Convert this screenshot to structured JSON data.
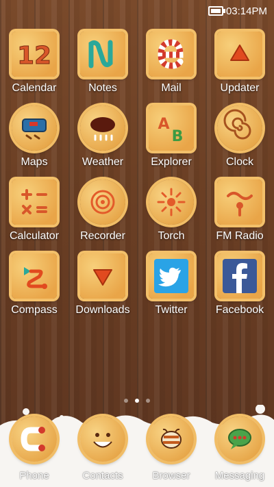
{
  "status_bar": {
    "time": "03:14PM"
  },
  "apps": [
    {
      "label": "Calendar",
      "icon": "calendar-icon"
    },
    {
      "label": "Notes",
      "icon": "notes-icon"
    },
    {
      "label": "Mail",
      "icon": "mail-icon"
    },
    {
      "label": "Updater",
      "icon": "updater-icon"
    },
    {
      "label": "Maps",
      "icon": "maps-icon"
    },
    {
      "label": "Weather",
      "icon": "weather-icon"
    },
    {
      "label": "Explorer",
      "icon": "explorer-icon"
    },
    {
      "label": "Clock",
      "icon": "clock-icon"
    },
    {
      "label": "Calculator",
      "icon": "calculator-icon"
    },
    {
      "label": "Recorder",
      "icon": "recorder-icon"
    },
    {
      "label": "Torch",
      "icon": "torch-icon"
    },
    {
      "label": "FM Radio",
      "icon": "radio-icon"
    },
    {
      "label": "Compass",
      "icon": "compass-icon"
    },
    {
      "label": "Downloads",
      "icon": "downloads-icon"
    },
    {
      "label": "Twitter",
      "icon": "twitter-icon"
    },
    {
      "label": "Facebook",
      "icon": "facebook-icon"
    }
  ],
  "page_indicator": {
    "count": 3,
    "active_index": 1
  },
  "dock": [
    {
      "label": "Phone",
      "icon": "phone-icon"
    },
    {
      "label": "Contacts",
      "icon": "contacts-icon"
    },
    {
      "label": "Browser",
      "icon": "browser-icon"
    },
    {
      "label": "Messaging",
      "icon": "messaging-icon"
    }
  ],
  "colors": {
    "wood": "#6b3f24",
    "cookie": "#f0b85a",
    "milk": "#f7f5f2",
    "twitter_blue": "#2aa3e6",
    "facebook_blue": "#3b5998"
  }
}
